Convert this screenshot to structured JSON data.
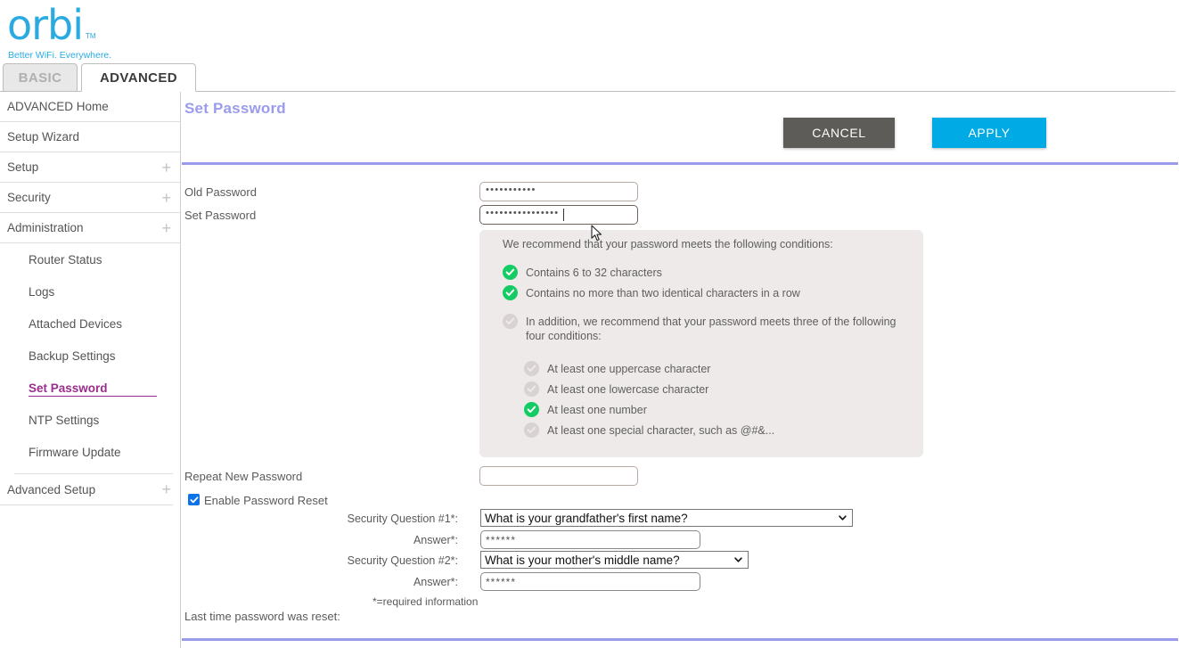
{
  "brand": {
    "name": "orbi",
    "tm": "TM",
    "tagline": "Better WiFi. Everywhere."
  },
  "tabs": [
    {
      "label": "BASIC",
      "active": false
    },
    {
      "label": "ADVANCED",
      "active": true
    }
  ],
  "sidebar": {
    "top_items": [
      {
        "label": "ADVANCED Home",
        "expandable": false
      },
      {
        "label": "Setup Wizard",
        "expandable": false
      },
      {
        "label": "Setup",
        "expandable": true,
        "plus": "+"
      },
      {
        "label": "Security",
        "expandable": true,
        "plus": "+"
      },
      {
        "label": "Administration",
        "expandable": true,
        "plus": "+"
      }
    ],
    "sub_items": [
      {
        "label": "Router Status",
        "active": false
      },
      {
        "label": "Logs",
        "active": false
      },
      {
        "label": "Attached Devices",
        "active": false
      },
      {
        "label": "Backup Settings",
        "active": false
      },
      {
        "label": "Set Password",
        "active": true
      },
      {
        "label": "NTP Settings",
        "active": false
      },
      {
        "label": "Firmware Update",
        "active": false
      }
    ],
    "bottom_items": [
      {
        "label": "Advanced Setup",
        "expandable": true,
        "plus": "+"
      }
    ]
  },
  "page": {
    "title": "Set Password",
    "cancel_label": "CANCEL",
    "apply_label": "APPLY"
  },
  "form": {
    "old_password_label": "Old Password",
    "old_password_value": "•••••••••••",
    "set_password_label": "Set Password",
    "set_password_value": "••••••••••••••••",
    "repeat_password_label": "Repeat New Password",
    "repeat_password_value": "",
    "enable_reset_label": "Enable Password Reset",
    "enable_reset_checked": true,
    "security_question_1_label": "Security Question #1*:",
    "security_question_1_value": "What is your grandfather's first name?",
    "answer_1_label": "Answer*:",
    "answer_1_value": "******",
    "security_question_2_label": "Security Question #2*:",
    "security_question_2_value": "What is your mother's middle name?",
    "answer_2_label": "Answer*:",
    "answer_2_value": "******",
    "required_note": "*=required information",
    "last_reset_label": "Last time password was reset:",
    "last_reset_value": ""
  },
  "recommendations": {
    "intro": "We recommend that your password meets the following conditions:",
    "primary": [
      {
        "label": "Contains 6 to 32 characters",
        "met": true
      },
      {
        "label": "Contains no more than two identical characters in a row",
        "met": true
      }
    ],
    "group_intro": {
      "label": "In addition, we recommend that your password meets three of the following four conditions:",
      "met": false
    },
    "secondary": [
      {
        "label": "At least one uppercase character",
        "met": false
      },
      {
        "label": "At least one lowercase character",
        "met": false
      },
      {
        "label": "At least one number",
        "met": true
      },
      {
        "label": "At least one special character, such as @#&...",
        "met": false
      }
    ]
  },
  "colors": {
    "brand_cyan": "#29abe2",
    "title_purple": "#9b9bee",
    "active_nav": "#9b2d8c",
    "apply_blue": "#00aae4",
    "cancel_grey": "#5e5c58",
    "check_green": "#15cb63",
    "check_grey": "#d8d2d2",
    "panel_bg": "#efeaea",
    "checkbox_blue": "#0b72e8"
  }
}
